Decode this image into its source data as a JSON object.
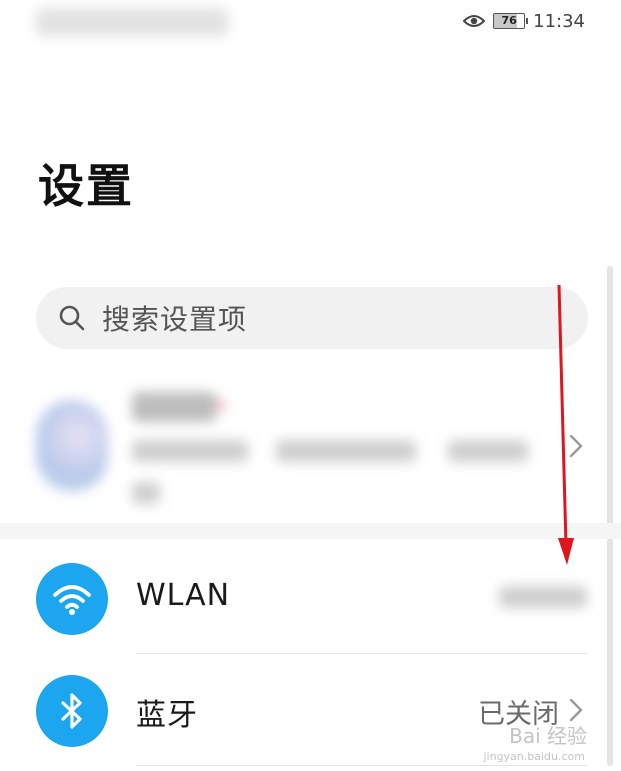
{
  "status_bar": {
    "time": "11:34",
    "battery": "76",
    "battery_level_percent": 76,
    "icons": [
      "eye-comfort-icon",
      "battery-icon"
    ]
  },
  "header": {
    "title": "设置"
  },
  "search": {
    "placeholder": "搜索设置项",
    "icon": "search-icon"
  },
  "settings": [
    {
      "id": "wlan",
      "label": "WLAN",
      "icon": "wifi-icon",
      "icon_color": "#1ca6ef"
    },
    {
      "id": "bluetooth",
      "label": "蓝牙",
      "value": "已关闭",
      "icon": "bluetooth-icon",
      "icon_color": "#1ca6ef"
    }
  ],
  "annotation": {
    "arrow_color": "#e0161e",
    "direction": "down"
  },
  "watermark": {
    "text": "Bai 经验",
    "sub": "jingyan.baidu.com"
  }
}
